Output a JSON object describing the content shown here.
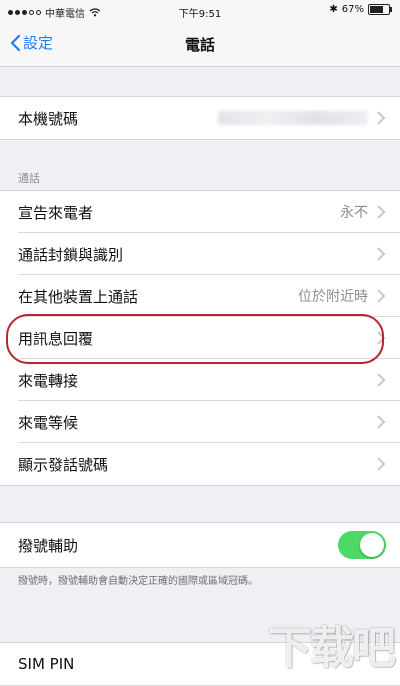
{
  "status_bar": {
    "carrier": "中華電信",
    "time": "下午9:51",
    "battery": "67%",
    "battery_level": 0.67
  },
  "nav": {
    "back_label": "設定",
    "title": "電話"
  },
  "my_number": {
    "label": "本機號碼"
  },
  "calls_section": {
    "header": "通話",
    "rows": [
      {
        "label": "宣告來電者",
        "value": "永不"
      },
      {
        "label": "通話封鎖與識別",
        "value": ""
      },
      {
        "label": "在其他裝置上通話",
        "value": "位於附近時"
      },
      {
        "label": "用訊息回覆",
        "value": ""
      },
      {
        "label": "來電轉接",
        "value": ""
      },
      {
        "label": "來電等候",
        "value": ""
      },
      {
        "label": "顯示發話號碼",
        "value": ""
      }
    ]
  },
  "dial_assist": {
    "label": "撥號輔助",
    "enabled": true,
    "footer": "撥號時，撥號輔助會自動決定正確的國際或區域冠碼。"
  },
  "sim_pin": {
    "label": "SIM PIN"
  },
  "watermark": {
    "text": "下载吧"
  },
  "colors": {
    "accent": "#1e7cf5",
    "toggle_on": "#4cd964",
    "highlight": "#b2282e"
  }
}
